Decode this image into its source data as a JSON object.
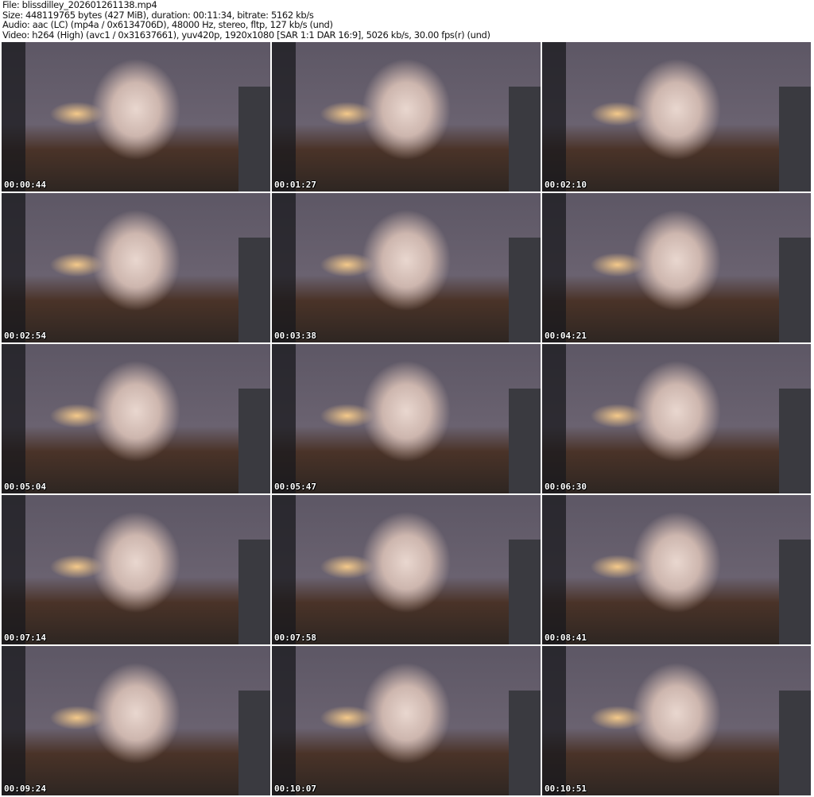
{
  "header": {
    "file": "File: blissdilley_202601261138.mp4",
    "size": "Size: 448119765 bytes (427 MiB), duration: 00:11:34, bitrate: 5162 kb/s",
    "audio": "Audio: aac (LC) (mp4a / 0x6134706D), 48000 Hz, stereo, fltp, 127 kb/s (und)",
    "video": "Video: h264 (High) (avc1 / 0x31637661), yuv420p, 1920x1080 [SAR 1:1 DAR 16:9], 5026 kb/s, 30.00 fps(r) (und)"
  },
  "thumbnails": [
    {
      "timestamp": "00:00:44"
    },
    {
      "timestamp": "00:01:27"
    },
    {
      "timestamp": "00:02:10"
    },
    {
      "timestamp": "00:02:54"
    },
    {
      "timestamp": "00:03:38"
    },
    {
      "timestamp": "00:04:21"
    },
    {
      "timestamp": "00:05:04"
    },
    {
      "timestamp": "00:05:47"
    },
    {
      "timestamp": "00:06:30"
    },
    {
      "timestamp": "00:07:14"
    },
    {
      "timestamp": "00:07:58"
    },
    {
      "timestamp": "00:08:41"
    },
    {
      "timestamp": "00:09:24"
    },
    {
      "timestamp": "00:10:07"
    },
    {
      "timestamp": "00:10:51"
    }
  ]
}
